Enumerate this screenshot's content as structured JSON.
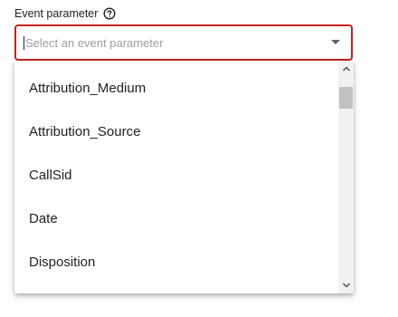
{
  "field": {
    "label": "Event parameter",
    "help_icon": "help-circle-icon",
    "placeholder": "Select an event parameter",
    "value": "",
    "state": "error",
    "error_color": "#c5221f"
  },
  "dropdown": {
    "expand_icon": "arrow-drop-down-icon",
    "options": [
      "Attribution_Medium",
      "Attribution_Source",
      "CallSid",
      "Date",
      "Disposition"
    ],
    "scrollbar": {
      "up_icon": "chevron-up-icon",
      "down_icon": "chevron-down-icon"
    }
  }
}
